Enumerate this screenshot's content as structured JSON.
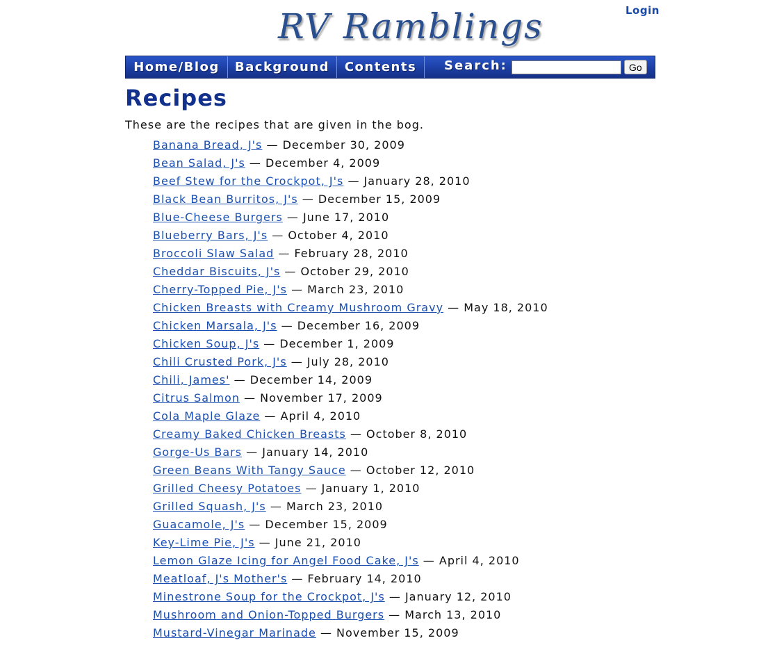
{
  "header": {
    "logo_text": "RV Ramblings",
    "login_label": "Login"
  },
  "nav": {
    "items": [
      {
        "label": "Home/Blog"
      },
      {
        "label": "Background"
      },
      {
        "label": "Contents"
      }
    ],
    "search_label": "Search:",
    "search_value": "",
    "go_label": "Go"
  },
  "page": {
    "title": "Recipes",
    "intro": "These are the recipes that are given in the bog."
  },
  "recipes": [
    {
      "name": "Banana Bread, J's",
      "date": "December 30, 2009"
    },
    {
      "name": "Bean Salad, J's",
      "date": "December 4, 2009"
    },
    {
      "name": "Beef Stew for the Crockpot, J's",
      "date": "January 28, 2010"
    },
    {
      "name": "Black Bean Burritos, J's",
      "date": "December 15, 2009"
    },
    {
      "name": "Blue-Cheese Burgers",
      "date": "June 17, 2010"
    },
    {
      "name": "Blueberry Bars, J's",
      "date": "October 4, 2010"
    },
    {
      "name": "Broccoli Slaw Salad",
      "date": "February 28, 2010"
    },
    {
      "name": "Cheddar Biscuits, J's",
      "date": "October 29, 2010"
    },
    {
      "name": "Cherry-Topped Pie, J's",
      "date": "March 23, 2010"
    },
    {
      "name": "Chicken Breasts with Creamy Mushroom Gravy",
      "date": "May 18, 2010"
    },
    {
      "name": "Chicken Marsala, J's",
      "date": "December 16, 2009"
    },
    {
      "name": "Chicken Soup, J's",
      "date": "December 1, 2009"
    },
    {
      "name": "Chili Crusted Pork, J's",
      "date": "July 28, 2010"
    },
    {
      "name": "Chili, James'",
      "date": "December 14, 2009"
    },
    {
      "name": "Citrus Salmon",
      "date": "November 17, 2009"
    },
    {
      "name": "Cola Maple Glaze",
      "date": "April 4, 2010"
    },
    {
      "name": "Creamy Baked Chicken Breasts",
      "date": "October 8, 2010"
    },
    {
      "name": "Gorge-Us Bars",
      "date": "January 14, 2010"
    },
    {
      "name": "Green Beans With Tangy Sauce",
      "date": "October 12, 2010"
    },
    {
      "name": "Grilled Cheesy Potatoes",
      "date": "January 1, 2010"
    },
    {
      "name": "Grilled Squash, J's",
      "date": "March 23, 2010"
    },
    {
      "name": "Guacamole, J's",
      "date": "December 15, 2009"
    },
    {
      "name": "Key-Lime Pie, J's",
      "date": "June 21, 2010"
    },
    {
      "name": "Lemon Glaze Icing for Angel Food Cake, J's",
      "date": "April 4, 2010"
    },
    {
      "name": "Meatloaf, J's Mother's",
      "date": "February 14, 2010"
    },
    {
      "name": "Minestrone Soup for the Crockpot, J's",
      "date": "January 12, 2010"
    },
    {
      "name": "Mushroom and Onion-Topped Burgers",
      "date": "March 13, 2010"
    },
    {
      "name": "Mustard-Vinegar Marinade",
      "date": "November 15, 2009"
    }
  ]
}
